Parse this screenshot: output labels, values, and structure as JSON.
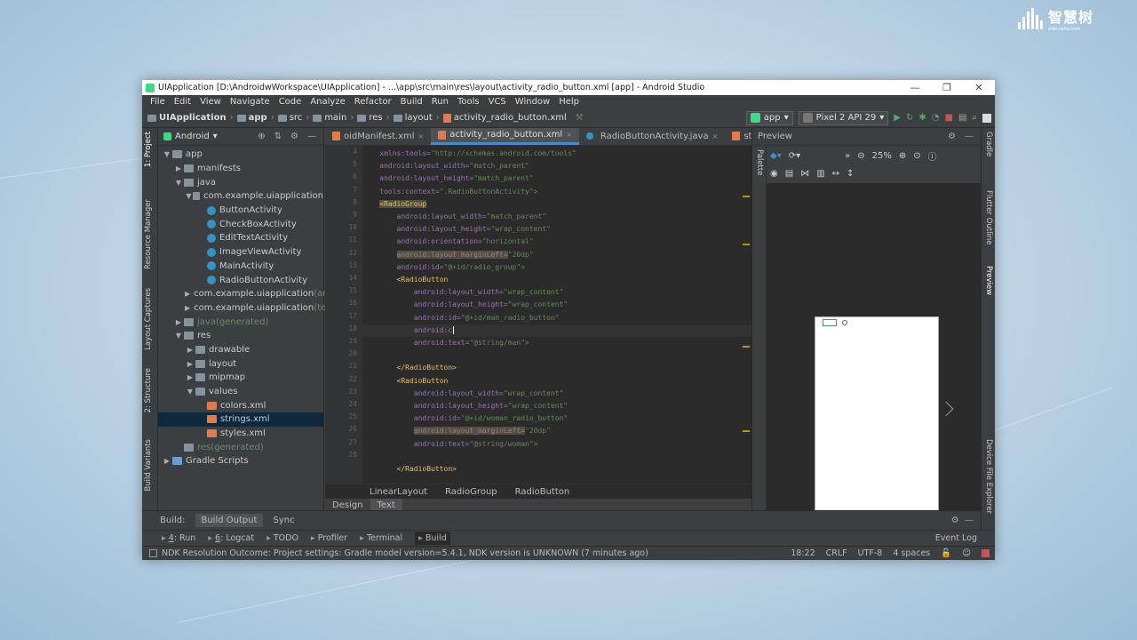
{
  "colors": {
    "accent": "#4a88c7",
    "bg": "#2b2b2b",
    "panel": "#3c3f41"
  },
  "watermark": {
    "text": "智慧树",
    "sub": "zhihuishu.com"
  },
  "window": {
    "title": "UIApplication [D:\\AndroidwWorkspace\\UIApplication] - ...\\app\\src\\main\\res\\layout\\activity_radio_button.xml [app] - Android Studio",
    "menu": [
      "File",
      "Edit",
      "View",
      "Navigate",
      "Code",
      "Analyze",
      "Refactor",
      "Build",
      "Run",
      "Tools",
      "VCS",
      "Window",
      "Help"
    ]
  },
  "navbar": {
    "crumbs": [
      "UIApplication",
      "app",
      "src",
      "main",
      "res",
      "layout",
      "activity_radio_button.xml"
    ],
    "run_config": "app",
    "device": "Pixel 2 API 29"
  },
  "left_strip": {
    "tabs": [
      "1: Project",
      "Resource Manager",
      "Layout Captures",
      "2: Structure",
      "Build Variants"
    ]
  },
  "right_strip": {
    "tabs": [
      "Gradle",
      "Flutter Outline",
      "Preview",
      "Device File Explorer"
    ]
  },
  "project": {
    "view": "Android",
    "tree": [
      {
        "label": "app",
        "depth": 0,
        "arrow": "▼",
        "icon": "folder",
        "selected": false,
        "suffix": ""
      },
      {
        "label": "manifests",
        "depth": 1,
        "arrow": "▶",
        "icon": "folder",
        "selected": false,
        "suffix": ""
      },
      {
        "label": "java",
        "depth": 1,
        "arrow": "▼",
        "icon": "folder",
        "selected": false,
        "suffix": ""
      },
      {
        "label": "com.example.uiapplication",
        "depth": 2,
        "arrow": "▼",
        "icon": "package",
        "selected": false,
        "suffix": ""
      },
      {
        "label": "ButtonActivity",
        "depth": 3,
        "arrow": "",
        "icon": "class",
        "selected": false,
        "suffix": ""
      },
      {
        "label": "CheckBoxActivity",
        "depth": 3,
        "arrow": "",
        "icon": "class",
        "selected": false,
        "suffix": ""
      },
      {
        "label": "EditTextActivity",
        "depth": 3,
        "arrow": "",
        "icon": "class",
        "selected": false,
        "suffix": ""
      },
      {
        "label": "ImageViewActivity",
        "depth": 3,
        "arrow": "",
        "icon": "class",
        "selected": false,
        "suffix": ""
      },
      {
        "label": "MainActivity",
        "depth": 3,
        "arrow": "",
        "icon": "class",
        "selected": false,
        "suffix": ""
      },
      {
        "label": "RadioButtonActivity",
        "depth": 3,
        "arrow": "",
        "icon": "class",
        "selected": false,
        "suffix": ""
      },
      {
        "label": "com.example.uiapplication",
        "depth": 2,
        "arrow": "▶",
        "icon": "package",
        "selected": false,
        "suffix": " (an"
      },
      {
        "label": "com.example.uiapplication",
        "depth": 2,
        "arrow": "▶",
        "icon": "package",
        "selected": false,
        "suffix": " (te"
      },
      {
        "label": "java",
        "depth": 1,
        "arrow": "▶",
        "icon": "folder",
        "selected": false,
        "suffix": " (generated)"
      },
      {
        "label": "res",
        "depth": 1,
        "arrow": "▼",
        "icon": "folder",
        "selected": false,
        "suffix": ""
      },
      {
        "label": "drawable",
        "depth": 2,
        "arrow": "▶",
        "icon": "folder",
        "selected": false,
        "suffix": ""
      },
      {
        "label": "layout",
        "depth": 2,
        "arrow": "▶",
        "icon": "folder",
        "selected": false,
        "suffix": ""
      },
      {
        "label": "mipmap",
        "depth": 2,
        "arrow": "▶",
        "icon": "folder",
        "selected": false,
        "suffix": ""
      },
      {
        "label": "values",
        "depth": 2,
        "arrow": "▼",
        "icon": "folder",
        "selected": false,
        "suffix": ""
      },
      {
        "label": "colors.xml",
        "depth": 3,
        "arrow": "",
        "icon": "xml",
        "selected": false,
        "suffix": ""
      },
      {
        "label": "strings.xml",
        "depth": 3,
        "arrow": "",
        "icon": "xml",
        "selected": true,
        "suffix": ""
      },
      {
        "label": "styles.xml",
        "depth": 3,
        "arrow": "",
        "icon": "xml",
        "selected": false,
        "suffix": ""
      },
      {
        "label": "res",
        "depth": 1,
        "arrow": "",
        "icon": "folder",
        "selected": false,
        "suffix": " (generated)"
      },
      {
        "label": "Gradle Scripts",
        "depth": 0,
        "arrow": "▶",
        "icon": "gradle",
        "selected": false,
        "suffix": ""
      }
    ]
  },
  "editor": {
    "tabs": [
      {
        "label": "oidManifest.xml",
        "active": false
      },
      {
        "label": "activity_radio_button.xml",
        "active": true
      },
      {
        "label": "RadioButtonActivity.java",
        "active": false
      },
      {
        "label": "strings.xml",
        "active": false
      }
    ],
    "line_numbers": [
      "4",
      "5",
      "6",
      "7",
      "8",
      "9",
      "10",
      "11",
      "12",
      "13",
      "14",
      "15",
      "16",
      "17",
      "18",
      "19",
      "20",
      "21",
      "22",
      "23",
      "24",
      "25",
      "26",
      "27",
      "28"
    ],
    "lines": [
      {
        "indent": "    ",
        "parts": [
          {
            "t": "xmlns:tools=",
            "c": "attr"
          },
          {
            "t": "\"http://schemas.android.com/tools\"",
            "c": "val"
          }
        ]
      },
      {
        "indent": "    ",
        "parts": [
          {
            "t": "android:",
            "c": "ns"
          },
          {
            "t": "layout_width=",
            "c": "attr"
          },
          {
            "t": "\"match_parent\"",
            "c": "val"
          }
        ]
      },
      {
        "indent": "    ",
        "parts": [
          {
            "t": "android:",
            "c": "ns"
          },
          {
            "t": "layout_height=",
            "c": "attr"
          },
          {
            "t": "\"match_parent\"",
            "c": "val"
          }
        ]
      },
      {
        "indent": "    ",
        "parts": [
          {
            "t": "tools:context=",
            "c": "attr"
          },
          {
            "t": "\".RadioButtonActivity\">",
            "c": "val"
          }
        ]
      },
      {
        "indent": "    ",
        "parts": [
          {
            "t": "<RadioGroup",
            "c": "tag hl"
          }
        ]
      },
      {
        "indent": "        ",
        "parts": [
          {
            "t": "android:",
            "c": "ns"
          },
          {
            "t": "layout_width=",
            "c": "attr"
          },
          {
            "t": "\"match_parent\"",
            "c": "val"
          }
        ]
      },
      {
        "indent": "        ",
        "parts": [
          {
            "t": "android:",
            "c": "ns"
          },
          {
            "t": "layout_height=",
            "c": "attr"
          },
          {
            "t": "\"wrap_content\"",
            "c": "val"
          }
        ]
      },
      {
        "indent": "        ",
        "parts": [
          {
            "t": "android:",
            "c": "ns"
          },
          {
            "t": "orientation=",
            "c": "attr"
          },
          {
            "t": "\"horizontal\"",
            "c": "val"
          }
        ]
      },
      {
        "indent": "        ",
        "parts": [
          {
            "t": "android:layout_marginLeft=",
            "c": "attr hl"
          },
          {
            "t": "\"20dp\"",
            "c": "val"
          }
        ]
      },
      {
        "indent": "        ",
        "parts": [
          {
            "t": "android:",
            "c": "ns"
          },
          {
            "t": "id=",
            "c": "attr"
          },
          {
            "t": "\"@+id/radio_group\">",
            "c": "val"
          }
        ]
      },
      {
        "indent": "        ",
        "parts": [
          {
            "t": "<RadioButton",
            "c": "tag"
          }
        ]
      },
      {
        "indent": "            ",
        "parts": [
          {
            "t": "android:",
            "c": "ns"
          },
          {
            "t": "layout_width=",
            "c": "attr"
          },
          {
            "t": "\"wrap_content\"",
            "c": "val"
          }
        ]
      },
      {
        "indent": "            ",
        "parts": [
          {
            "t": "android:",
            "c": "ns"
          },
          {
            "t": "layout_height=",
            "c": "attr"
          },
          {
            "t": "\"wrap_content\"",
            "c": "val"
          }
        ]
      },
      {
        "indent": "            ",
        "parts": [
          {
            "t": "android:",
            "c": "ns"
          },
          {
            "t": "id=",
            "c": "attr"
          },
          {
            "t": "\"@+id/man_radio_button\"",
            "c": "val"
          }
        ]
      },
      {
        "indent": "            ",
        "parts": [
          {
            "t": "android:c",
            "c": "attr"
          }
        ],
        "cur": true
      },
      {
        "indent": "            ",
        "parts": [
          {
            "t": "android:",
            "c": "ns"
          },
          {
            "t": "text=",
            "c": "attr"
          },
          {
            "t": "\"@string/man\">",
            "c": "val"
          }
        ]
      },
      {
        "indent": "",
        "parts": []
      },
      {
        "indent": "        ",
        "parts": [
          {
            "t": "</RadioButton>",
            "c": "tag"
          }
        ]
      },
      {
        "indent": "        ",
        "parts": [
          {
            "t": "<RadioButton",
            "c": "tag"
          }
        ]
      },
      {
        "indent": "            ",
        "parts": [
          {
            "t": "android:",
            "c": "ns"
          },
          {
            "t": "layout_width=",
            "c": "attr"
          },
          {
            "t": "\"wrap_content\"",
            "c": "val"
          }
        ]
      },
      {
        "indent": "            ",
        "parts": [
          {
            "t": "android:",
            "c": "ns"
          },
          {
            "t": "layout_height=",
            "c": "attr"
          },
          {
            "t": "\"wrap_content\"",
            "c": "val"
          }
        ]
      },
      {
        "indent": "            ",
        "parts": [
          {
            "t": "android:",
            "c": "ns"
          },
          {
            "t": "id=",
            "c": "attr"
          },
          {
            "t": "\"@+id/woman_radio_button\"",
            "c": "val"
          }
        ]
      },
      {
        "indent": "            ",
        "parts": [
          {
            "t": "android:layout_marginLeft=",
            "c": "attr hl"
          },
          {
            "t": "\"20dp\"",
            "c": "val"
          }
        ]
      },
      {
        "indent": "            ",
        "parts": [
          {
            "t": "android:",
            "c": "ns"
          },
          {
            "t": "text=",
            "c": "attr"
          },
          {
            "t": "\"@string/woman\">",
            "c": "val"
          }
        ]
      },
      {
        "indent": "",
        "parts": []
      },
      {
        "indent": "        ",
        "parts": [
          {
            "t": "</RadioButton>",
            "c": "tag"
          }
        ]
      }
    ],
    "breadcrumb": [
      "LinearLayout",
      "RadioGroup",
      "RadioButton"
    ],
    "design_tabs": [
      {
        "label": "Design",
        "active": false
      },
      {
        "label": "Text",
        "active": true
      }
    ]
  },
  "preview": {
    "title": "Preview",
    "zoom": "25%",
    "palette_label": "Palette"
  },
  "bottom": {
    "label": "Build:",
    "tabs": [
      "Build Output",
      "Sync"
    ]
  },
  "toolwindows": [
    {
      "key": "4",
      "label": ": Run",
      "active": false
    },
    {
      "key": "6",
      "label": ": Logcat",
      "active": false
    },
    {
      "key": "",
      "label": "TODO",
      "active": false
    },
    {
      "key": "",
      "label": "Profiler",
      "active": false
    },
    {
      "key": "",
      "label": "Terminal",
      "active": false
    },
    {
      "key": "",
      "label": "Build",
      "active": true
    }
  ],
  "event_log": "Event Log",
  "status": {
    "message": "NDK Resolution Outcome: Project settings: Gradle model version=5.4.1, NDK version is UNKNOWN (7 minutes ago)",
    "position": "18:22",
    "line_sep": "CRLF",
    "encoding": "UTF-8",
    "indent": "4 spaces"
  }
}
